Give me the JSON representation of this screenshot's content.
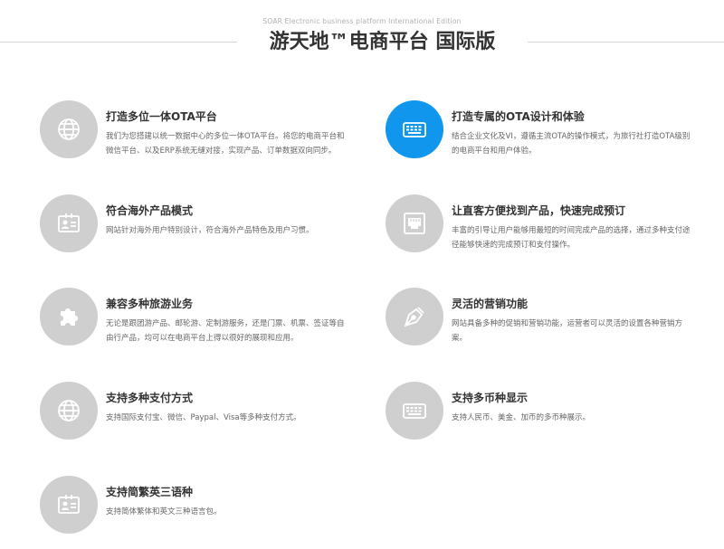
{
  "header": {
    "subtitle": "SOAR Electronic business platform International Edition",
    "title": "游天地™电商平台 国际版"
  },
  "features": [
    {
      "title": "打造多位一体OTA平台",
      "desc": "我们为您搭建以统一数据中心的多位一体OTA平台。将您的电商平台和微信平台、以及ERP系统无缝对接，实现产品、订单数据双向同步。",
      "icon": "globe-icon"
    },
    {
      "title": "打造专属的OTA设计和体验",
      "desc": "结合企业文化及VI，遵循主流OTA的操作模式，为旅行社打造OTA级别的电商平台和用户体验。",
      "icon": "keyboard-icon"
    },
    {
      "title": "符合海外产品模式",
      "desc": "网站针对海外用户特别设计，符合海外产品特色及用户习惯。",
      "icon": "id-card-icon"
    },
    {
      "title": "让直客方便找到产品，快速完成预订",
      "desc": "丰富的引导让用户能够用最短的时间完成产品的选择，通过多种支付途径能够快速的完成预订和支付操作。",
      "icon": "ethernet-port-icon"
    },
    {
      "title": "兼容多种旅游业务",
      "desc": "无论是跟团游产品、邮轮游、定制游服务，还是门票、机票、签证等自由行产品，均可以在电商平台上得以很好的展现和应用。",
      "icon": "puzzle-icon"
    },
    {
      "title": "灵活的营销功能",
      "desc": "网站具备多种的促销和营销功能，运营者可以灵活的设置各种营销方案。",
      "icon": "pen-nib-icon"
    },
    {
      "title": "支持多种支付方式",
      "desc": "支持国际支付宝、微信、Paypal、Visa等多种支付方式。",
      "icon": "globe-icon"
    },
    {
      "title": "支持多币种显示",
      "desc": "支持人民币、美金、加币的多币种展示。",
      "icon": "keyboard-icon"
    },
    {
      "title": "支持简繁英三语种",
      "desc": "支持简体繁体和英文三种语言包。",
      "icon": "id-card-icon"
    }
  ],
  "colors": {
    "active_icon_bg": "#1196ee",
    "icon_bg": "#cfcfcf",
    "title_text": "#333333",
    "desc_text": "#666666"
  }
}
